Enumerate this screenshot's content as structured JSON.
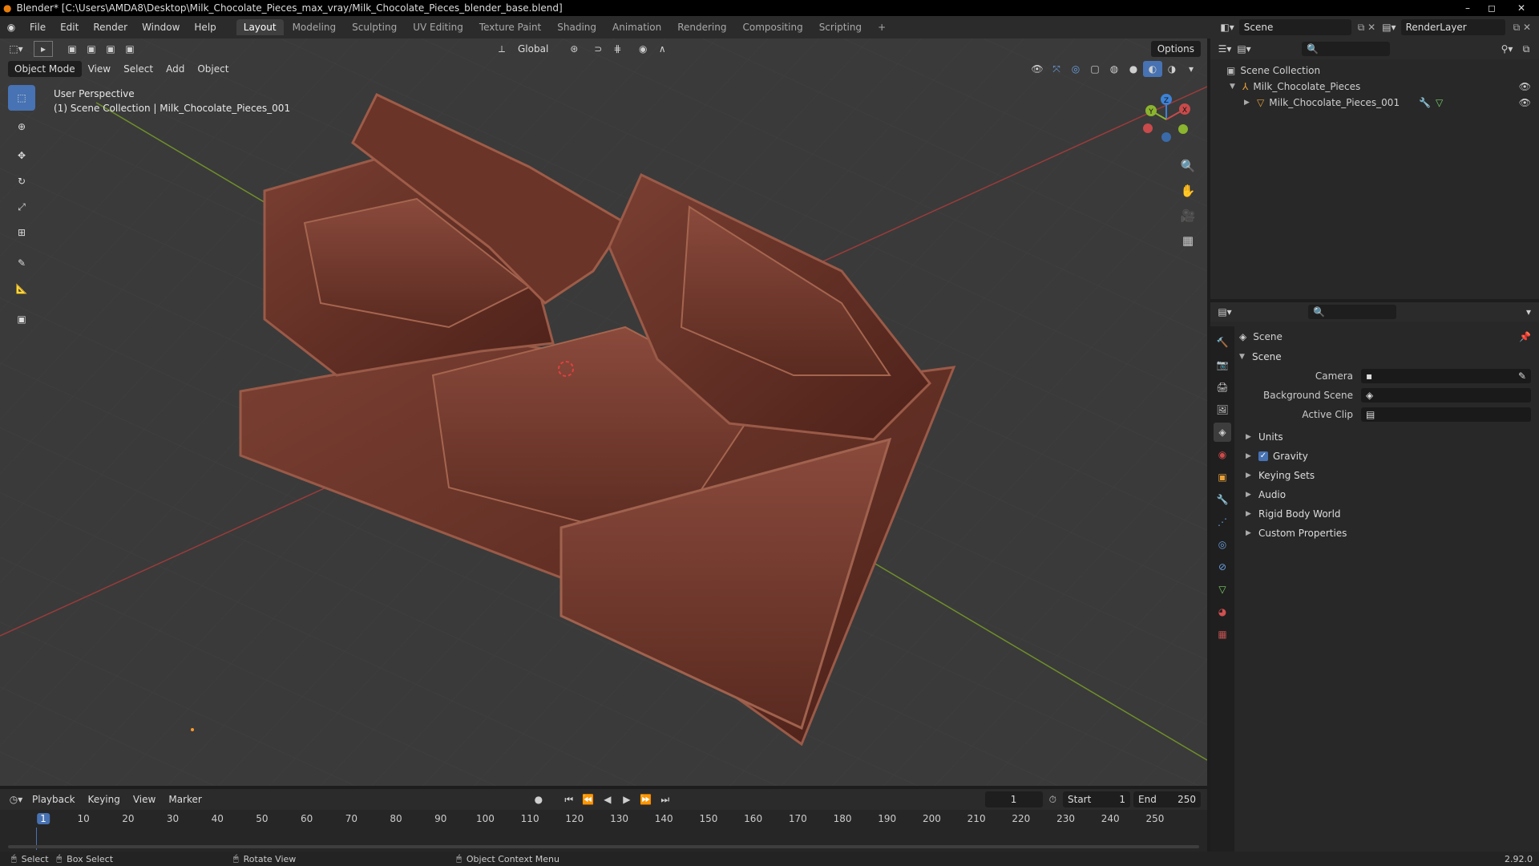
{
  "window": {
    "title": "Blender* [C:\\Users\\AMDA8\\Desktop\\Milk_Chocolate_Pieces_max_vray/Milk_Chocolate_Pieces_blender_base.blend]",
    "minimize": "–",
    "maximize": "◻",
    "close": "✕"
  },
  "menu": [
    "File",
    "Edit",
    "Render",
    "Window",
    "Help"
  ],
  "workspaces": [
    "Layout",
    "Modeling",
    "Sculpting",
    "UV Editing",
    "Texture Paint",
    "Shading",
    "Animation",
    "Rendering",
    "Compositing",
    "Scripting"
  ],
  "add_workspace": "+",
  "scene_field": "Scene",
  "renderlayer_field": "RenderLayer",
  "viewport": {
    "orientation": "Global",
    "options_label": "Options",
    "mode": "Object Mode",
    "header_menus": [
      "View",
      "Select",
      "Add",
      "Object"
    ],
    "overlay_line1": "User Perspective",
    "overlay_line2": "(1) Scene Collection | Milk_Chocolate_Pieces_001",
    "gizmo": {
      "x": "X",
      "y": "Y",
      "z": "Z"
    }
  },
  "outliner": {
    "root": "Scene Collection",
    "collection": "Milk_Chocolate_Pieces",
    "object": "Milk_Chocolate_Pieces_001"
  },
  "properties": {
    "context": "Scene",
    "panel": "Scene",
    "camera_label": "Camera",
    "bg_scene_label": "Background Scene",
    "active_clip_label": "Active Clip",
    "subpanels": [
      "Units",
      "Gravity",
      "Keying Sets",
      "Audio",
      "Rigid Body World",
      "Custom Properties"
    ],
    "gravity_checked": true
  },
  "timeline": {
    "menus": [
      "Playback",
      "Keying",
      "View",
      "Marker"
    ],
    "current_frame": "1",
    "start_label": "Start",
    "start_value": "1",
    "end_label": "End",
    "end_value": "250",
    "ticks": [
      "1",
      "10",
      "20",
      "30",
      "40",
      "50",
      "60",
      "70",
      "80",
      "90",
      "100",
      "110",
      "120",
      "130",
      "140",
      "150",
      "160",
      "170",
      "180",
      "190",
      "200",
      "210",
      "220",
      "230",
      "240",
      "250"
    ]
  },
  "status": {
    "select": "Select",
    "box_select": "Box Select",
    "rotate_view": "Rotate View",
    "context_menu": "Object Context Menu",
    "version": "2.92.0"
  },
  "colors": {
    "accent": "#4772b3",
    "x_axis": "#c94a4a",
    "y_axis": "#8bb42f",
    "z_axis": "#3d82d6",
    "chocolate": "#6b3326"
  }
}
